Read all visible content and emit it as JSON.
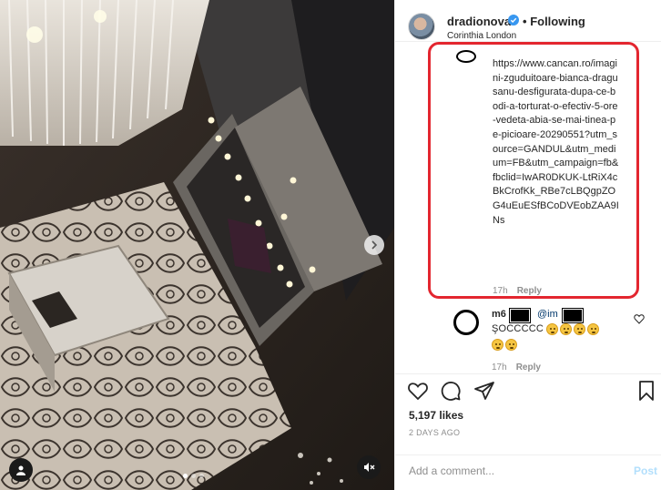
{
  "post": {
    "username": "dradionova",
    "follow_status": "Following",
    "separator": "•",
    "location": "Corinthia London",
    "likes": "5,197 likes",
    "date": "2 DAYS AGO"
  },
  "comments": [
    {
      "text": "https://www.cancan.ro/imagini-zguduitoare-bianca-dragusanu-desfigurata-dupa-ce-bodi-a-torturat-o-efectiv-5-ore-vedeta-abia-se-mai-tinea-pe-picioare-20290551?utm_source=GANDUL&utm_medium=FB&utm_campaign=fb&fbclid=IwAR0DKUK-LtRiX4cBkCrofKk_RBe7cLBQgpZOG4uEuESfBCoDVEobZAA9INs",
      "time": "17h",
      "reply_label": "Reply"
    },
    {
      "username": "m6",
      "mention": "@im",
      "text": "ŞOCCCCC",
      "time": "17h",
      "reply_label": "Reply"
    }
  ],
  "add_comment": {
    "placeholder": "Add a comment...",
    "post_label": "Post"
  },
  "icons": [
    "verified-icon",
    "heart-icon",
    "comment-icon",
    "share-icon",
    "bookmark-icon",
    "chevron-right-icon",
    "user-tag-icon",
    "mute-icon"
  ],
  "colors": {
    "highlight": "#e3262f",
    "verified": "#3897f0",
    "post_disabled": "#b2dffc"
  }
}
